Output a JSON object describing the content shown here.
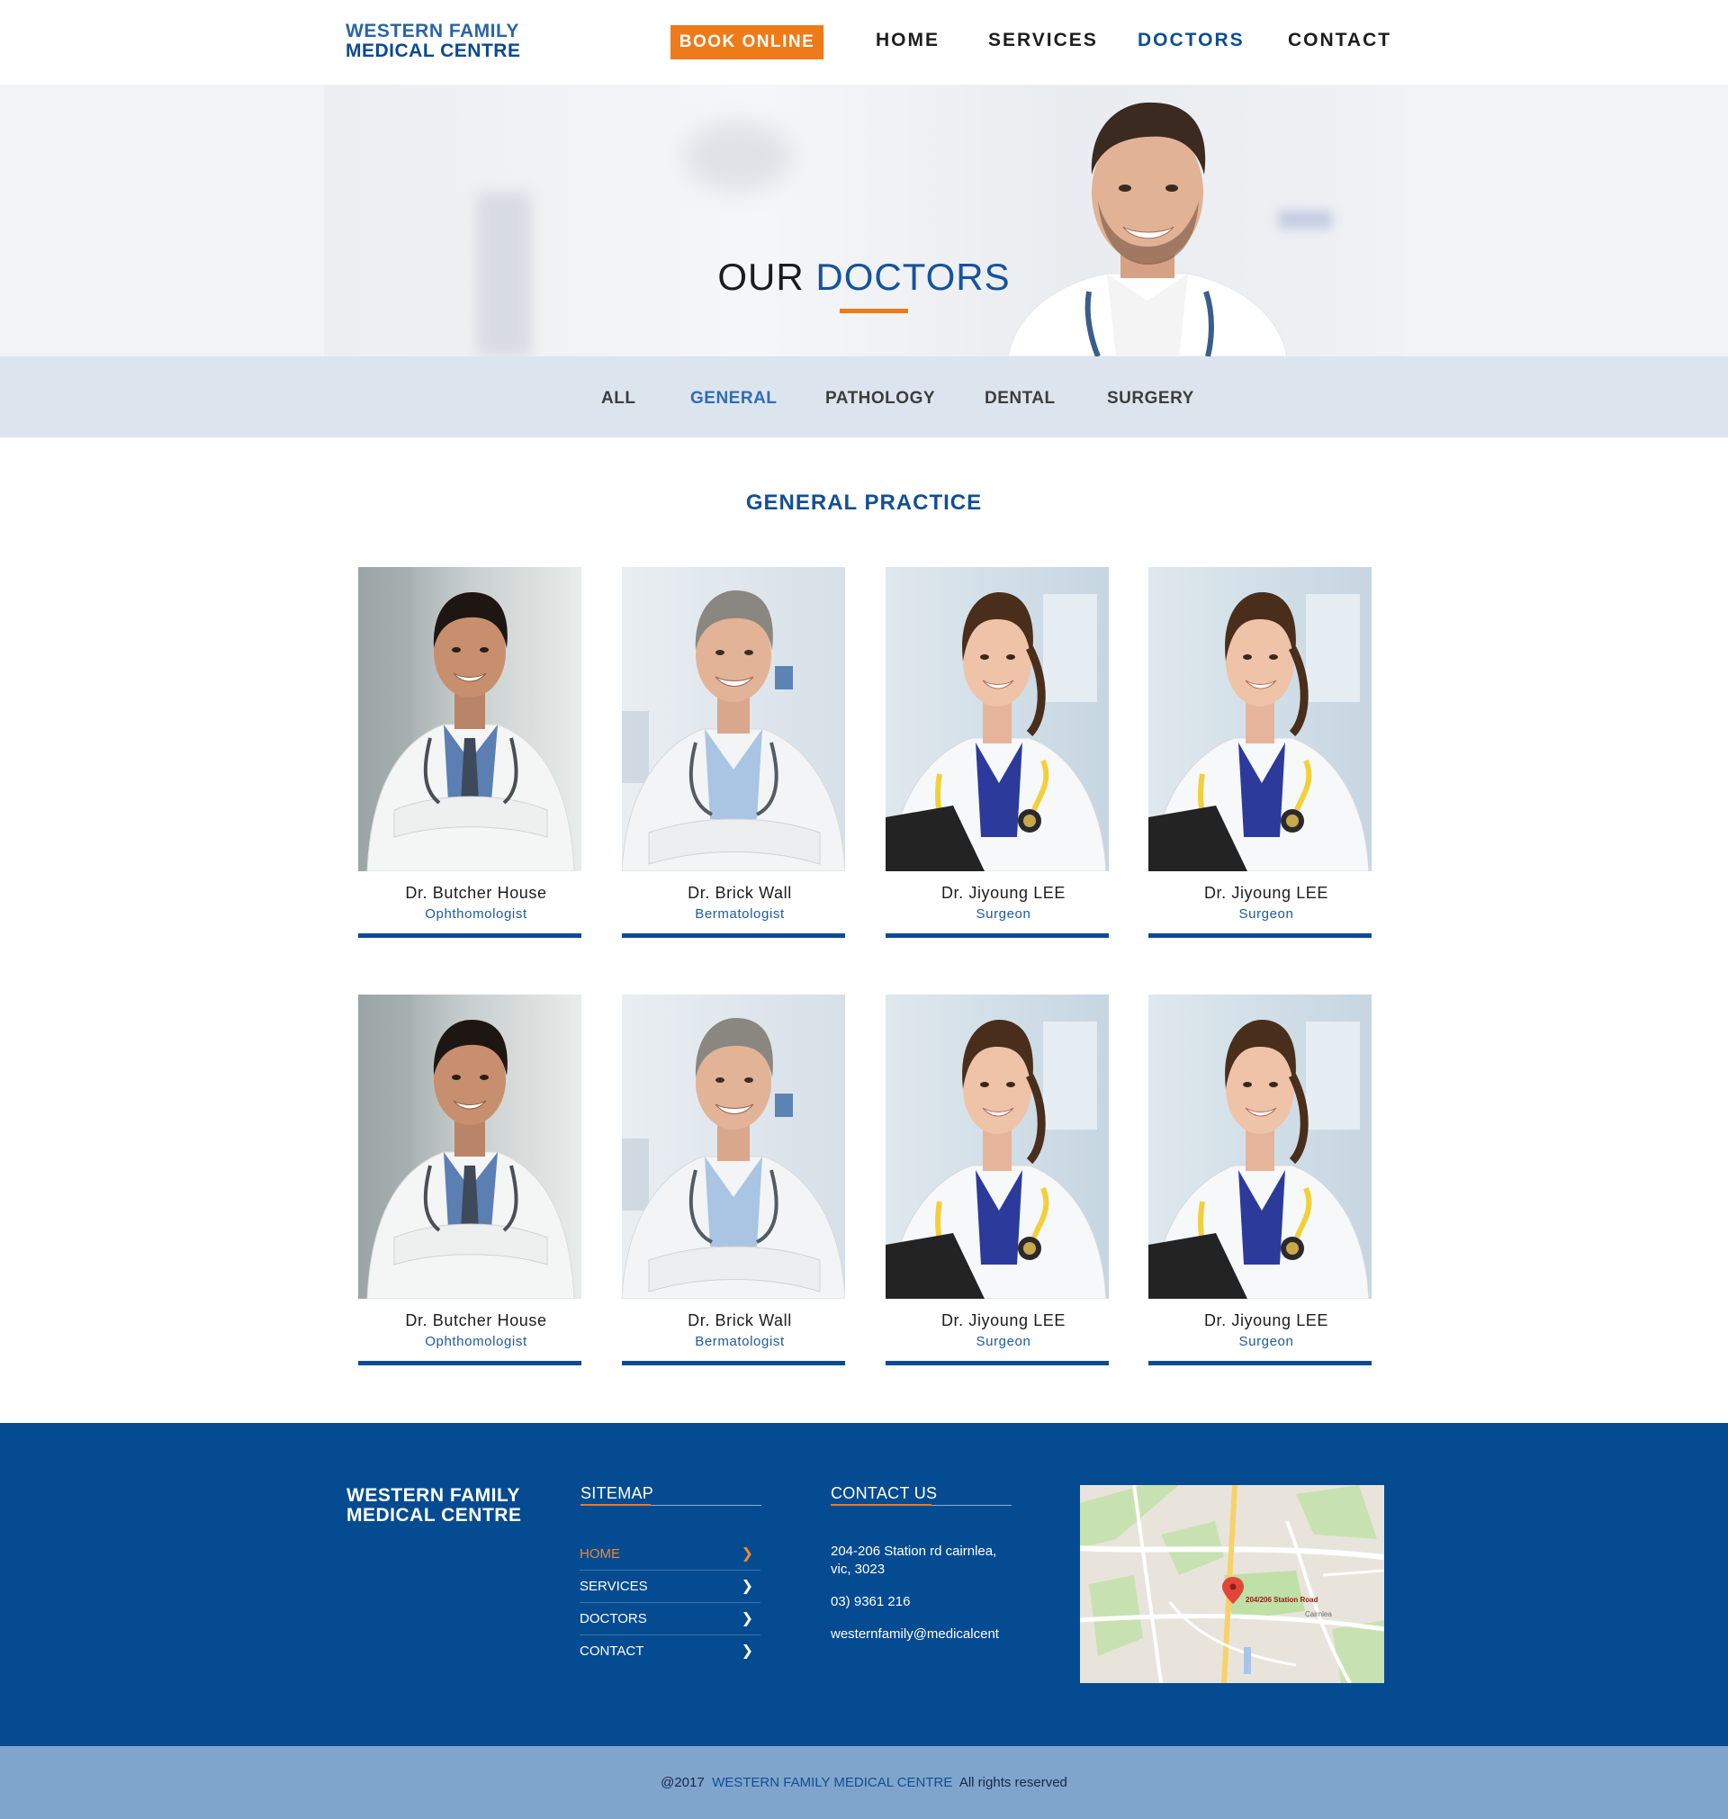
{
  "header": {
    "logo_line1": "WESTERN FAMILY",
    "logo_line2": "MEDICAL CENTRE",
    "book_label": "BOOK ONLINE",
    "nav": {
      "home": "HOME",
      "services": "SERVICES",
      "doctors": "DOCTORS",
      "contact": "CONTACT"
    },
    "active_nav": "DOCTORS"
  },
  "hero": {
    "title_plain": "OUR",
    "title_accent": "DOCTORS"
  },
  "filters": {
    "all": "ALL",
    "general": "GENERAL",
    "pathology": "PATHOLOGY",
    "dental": "DENTAL",
    "surgery": "SURGERY",
    "active": "GENERAL"
  },
  "section": {
    "title": "GENERAL PRACTICE"
  },
  "doctors": [
    {
      "name": "Dr. Butcher House",
      "role": "Ophthomologist",
      "photo": "young-man-doctor"
    },
    {
      "name": "Dr. Brick Wall",
      "role": "Bermatologist",
      "photo": "older-man-doctor"
    },
    {
      "name": "Dr. Jiyoung LEE",
      "role": "Surgeon",
      "photo": "woman-doctor"
    },
    {
      "name": "Dr. Jiyoung LEE",
      "role": "Surgeon",
      "photo": "woman-doctor"
    },
    {
      "name": "Dr. Butcher House",
      "role": "Ophthomologist",
      "photo": "young-man-doctor"
    },
    {
      "name": "Dr. Brick Wall",
      "role": "Bermatologist",
      "photo": "older-man-doctor"
    },
    {
      "name": "Dr. Jiyoung LEE",
      "role": "Surgeon",
      "photo": "woman-doctor"
    },
    {
      "name": "Dr. Jiyoung LEE",
      "role": "Surgeon",
      "photo": "woman-doctor"
    }
  ],
  "footer": {
    "logo_line1": "WESTERN FAMILY",
    "logo_line2": "MEDICAL CENTRE",
    "sitemap_title": "SITEMAP",
    "sitemap": [
      "HOME",
      "SERVICES",
      "DOCTORS",
      "CONTACT"
    ],
    "contact_title": "CONTACT US",
    "address_line1": "204-206 Station rd cairnlea,",
    "address_line2": "vic, 3023",
    "phone": "03) 9361 216",
    "email": "westernfamily@medicalcent",
    "map_pin_label": "204/206 Station Road",
    "map_area_label": "Cairnlea"
  },
  "copyright": {
    "prefix": "@2017",
    "brand": "WESTERN FAMILY MEDICAL CENTRE",
    "suffix": "All rights reserved"
  },
  "colors": {
    "brand_blue": "#0f4d93",
    "accent_orange": "#ef7a1a",
    "footer_bg": "#054b91",
    "filter_bg": "#dce5ee",
    "copyright_bg": "#80a5cd"
  }
}
